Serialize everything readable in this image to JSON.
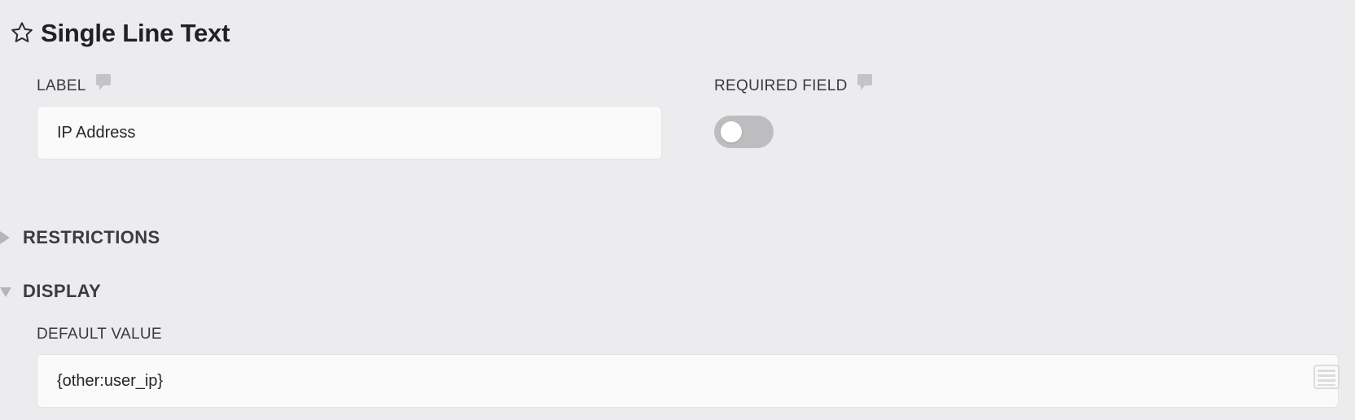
{
  "header": {
    "title": "Single Line Text",
    "star_icon": "star-outline-icon"
  },
  "fields": {
    "label": {
      "label": "LABEL",
      "value": "IP Address",
      "help_icon": "comment-icon"
    },
    "required": {
      "label": "REQUIRED FIELD",
      "enabled": false,
      "help_icon": "comment-icon"
    }
  },
  "sections": {
    "restrictions": {
      "title": "RESTRICTIONS",
      "expanded": false
    },
    "display": {
      "title": "DISPLAY",
      "expanded": true,
      "default_value": {
        "label": "DEFAULT VALUE",
        "value": "{other:user_ip}",
        "smart_tags_icon": "list-icon"
      }
    }
  },
  "colors": {
    "background": "#ececee",
    "input_background": "#fafafa",
    "toggle_off": "#bdbdc0",
    "icon_muted": "#c4c4c7"
  }
}
